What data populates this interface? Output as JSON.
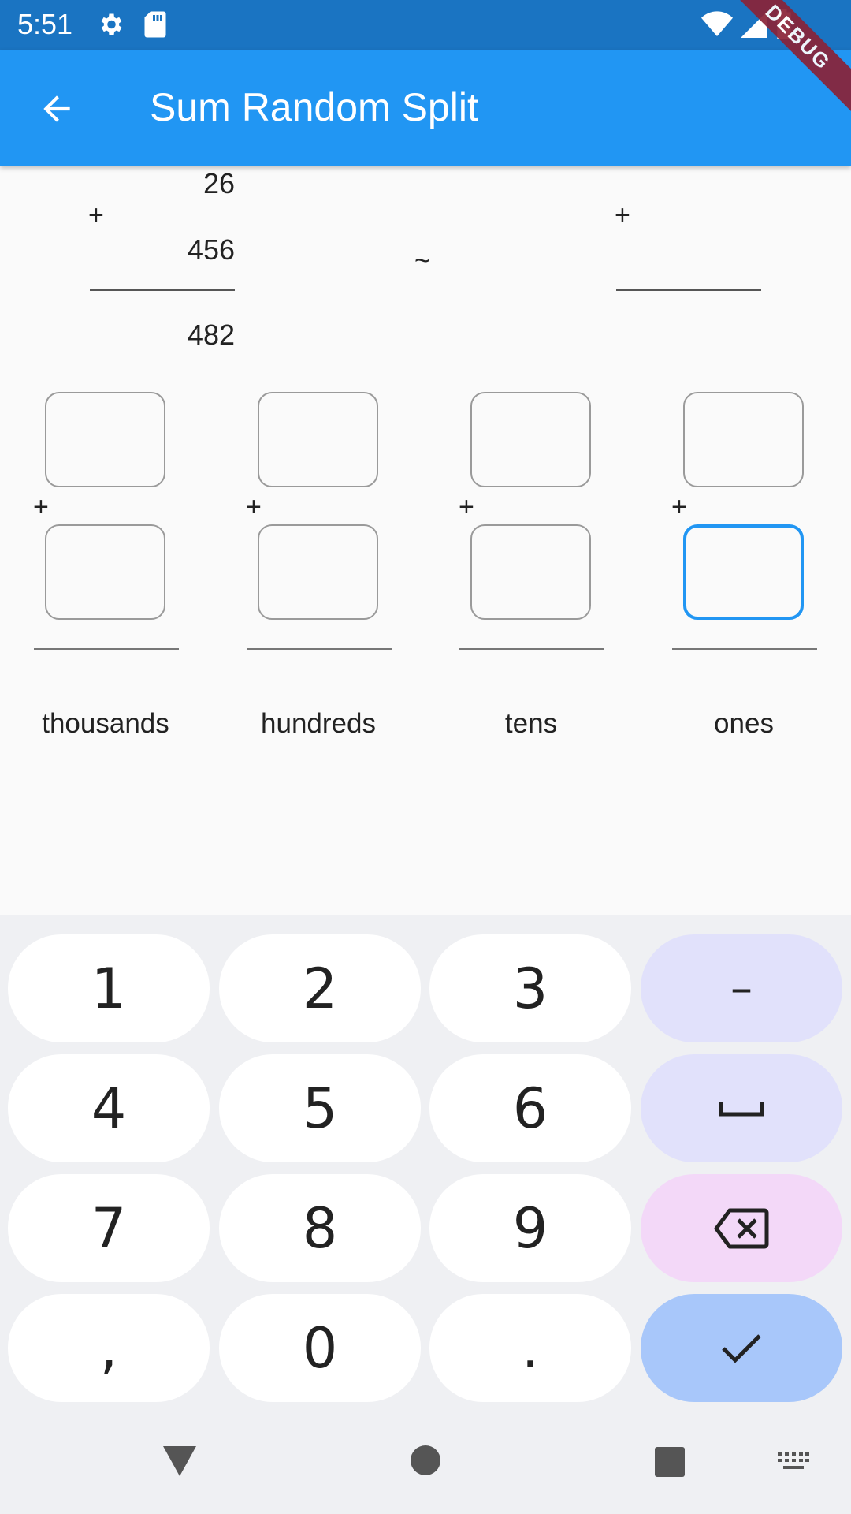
{
  "status_bar": {
    "time": "5:51",
    "icons": [
      "gear-icon",
      "sd-card-icon",
      "wifi-icon",
      "signal-icon",
      "battery-icon"
    ]
  },
  "debug_banner": "DEBUG",
  "app_bar": {
    "title": "Sum Random Split",
    "back_icon": "arrow-left-icon",
    "color": "#2196f3"
  },
  "problem": {
    "addend_top": "26",
    "operator": "+",
    "addend_bottom": "456",
    "sum": "482",
    "approx_symbol": "~",
    "estimate_operator": "+"
  },
  "columns": [
    {
      "label": "thousands",
      "operator": "+"
    },
    {
      "label": "hundreds",
      "operator": "+"
    },
    {
      "label": "tens",
      "operator": "+"
    },
    {
      "label": "ones",
      "operator": "+"
    }
  ],
  "keypad": {
    "keys": [
      "1",
      "2",
      "3",
      "–",
      "4",
      "5",
      "6",
      "␣",
      "7",
      "8",
      "9",
      "backspace",
      ",",
      "0",
      ".",
      "done"
    ],
    "colors": {
      "key": "#ffffff",
      "func": "#e1e1fb",
      "delete": "#f3d8f8",
      "done": "#a8c7fa"
    }
  },
  "nav_bar": {
    "icons": [
      "back-triangle-icon",
      "home-circle-icon",
      "recents-square-icon",
      "keyboard-icon"
    ]
  }
}
